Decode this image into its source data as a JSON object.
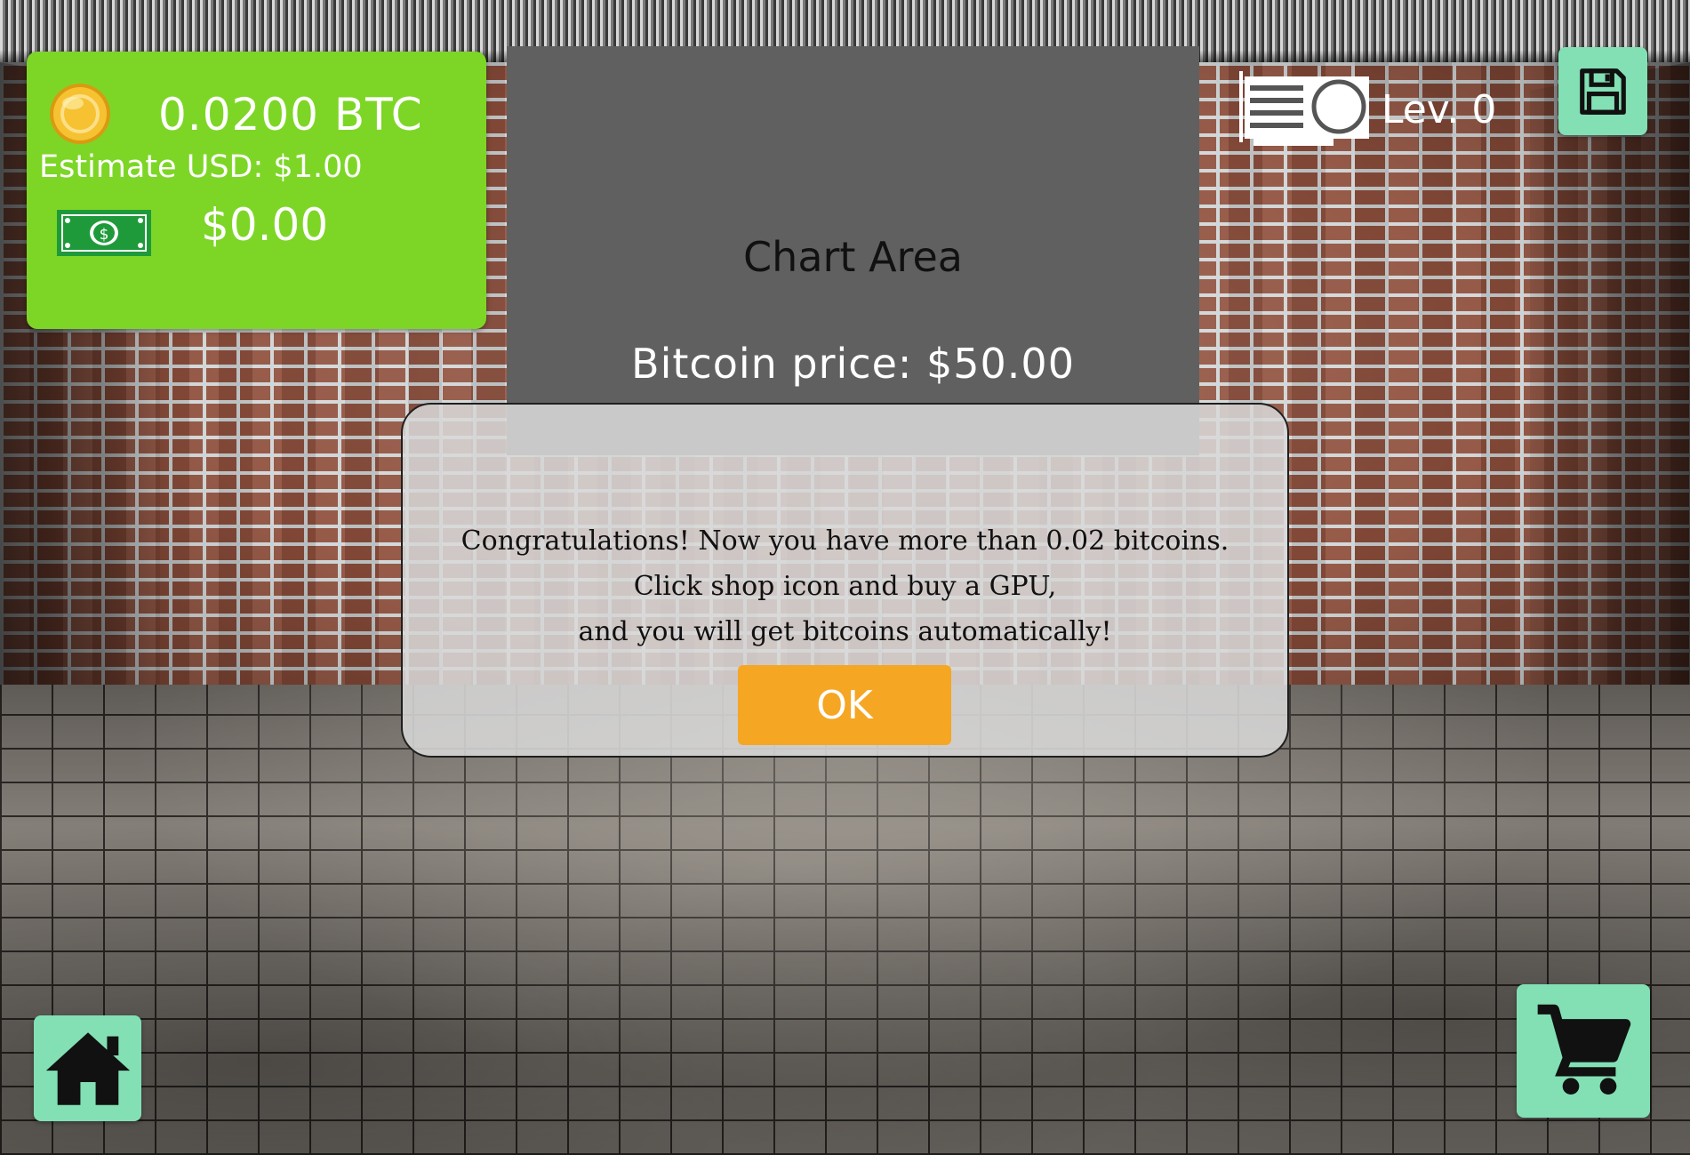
{
  "balance": {
    "btc": "0.0200 BTC",
    "estimate_usd": "Estimate USD: $1.00",
    "usd": "$0.00",
    "coin_icon": "bitcoin-coin-icon",
    "cash_icon": "dollar-bill-icon"
  },
  "chart": {
    "label": "Chart Area",
    "bitcoin_price": "Bitcoin price: $50.00"
  },
  "gpu": {
    "icon": "gpu-card-icon",
    "level": "Lev. 0"
  },
  "toolbar": {
    "save_icon": "floppy-disk-icon",
    "home_icon": "home-icon",
    "cart_icon": "shopping-cart-icon"
  },
  "dialog": {
    "lines": [
      "Congratulations! Now you have more than 0.02 bitcoins.",
      "Click shop icon and buy a GPU,",
      "and you will get bitcoins automatically!"
    ],
    "ok_label": "OK"
  },
  "colors": {
    "balance_panel": "#7dd626",
    "button_bg": "#82e0b4",
    "ok_button": "#f5a623",
    "chart_bg": "#606060"
  }
}
